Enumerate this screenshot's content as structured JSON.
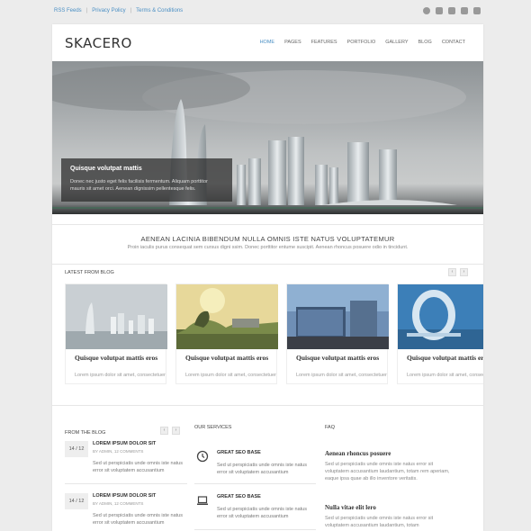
{
  "topbar": {
    "links": [
      "RSS Feeds",
      "Privacy Policy",
      "Terms & Conditions"
    ],
    "social_icons": [
      "dribbble-icon",
      "twitter-icon",
      "facebook-icon",
      "vimeo-icon",
      "youtube-icon"
    ]
  },
  "header": {
    "logo": "SKACERO",
    "nav": [
      "HOME",
      "PAGES",
      "FEATURES",
      "PORTFOLIO",
      "GALLERY",
      "BLOG",
      "CONTACT"
    ],
    "active": "HOME"
  },
  "hero": {
    "caption_title": "Quisque volutpat mattis",
    "caption_text": "Donec nec justo eget felis facilisis fermentum. Aliquam porttitor mauris sit amet orci. Aenean dignissim pellentesque felis."
  },
  "intro": {
    "title": "AENEAN LACINIA BIBENDUM NULLA OMNIS ISTE NATUS VOLUPTATEMUR",
    "text": "Proin iaculis purus consequat sem cursus digni ssim. Donec porttitor entume suscipit. Aenean rhoncus posuere odio in tincidunt."
  },
  "latest": {
    "title": "LATEST FROM BLOG",
    "prev": "‹",
    "next": "›",
    "cards": [
      {
        "title": "Quisque volutpat mattis eros",
        "text": "Lorem ipsum dolor sit amet, consectetuer"
      },
      {
        "title": "Quisque volutpat mattis eros",
        "text": "Lorem ipsum dolor sit amet, consectetuer"
      },
      {
        "title": "Quisque volutpat mattis eros",
        "text": "Lorem ipsum dolor sit amet, consectetuer"
      },
      {
        "title": "Quisque volutpat mattis eros",
        "text": "Lorem ipsum dolor sit amet, consectetuer"
      }
    ]
  },
  "from_blog": {
    "title": "FROM THE BLOG",
    "prev": "‹",
    "next": "›",
    "items": [
      {
        "date": "14 / 12",
        "title": "LOREM IPSUM DOLOR SIT",
        "meta": "BY ADMIN, 12 COMMENTS",
        "text": "Sed ut perspiciatis unde omnis iste natus error sit voluptatem accusantium"
      },
      {
        "date": "14 / 12",
        "title": "LOREM IPSUM DOLOR SIT",
        "meta": "BY ADMIN, 12 COMMENTS",
        "text": "Sed ut perspiciatis unde omnis iste natus error sit voluptatem accusantium"
      }
    ]
  },
  "services": {
    "title": "OUR SERVICES",
    "items": [
      {
        "icon": "clock-icon",
        "title": "GREAT SEO BASE",
        "text": "Sed ut perspiciatis unde omnis iste natus error sit voluptatem accusantium"
      },
      {
        "icon": "laptop-icon",
        "title": "GREAT SEO BASE",
        "text": "Sed ut perspiciatis unde omnis iste natus error sit voluptatem accusantium"
      }
    ]
  },
  "faq": {
    "title": "FAQ",
    "items": [
      {
        "q": "Aenean rhoncus posuere",
        "a": "Sed ut perspiciatis unde omnis iste natus error sit voluptatem accusantium laudantium, totam rem aperiam, eaque ipsa quae ab illo inventore veritatis."
      },
      {
        "q": "Nulla vitae elit lero",
        "a": "Sed ut perspiciatis unde omnis iste natus error sit voluptatem accusantium laudantium, totam"
      }
    ]
  },
  "colors": {
    "accent": "#4a8fc4",
    "background": "#ececec"
  }
}
